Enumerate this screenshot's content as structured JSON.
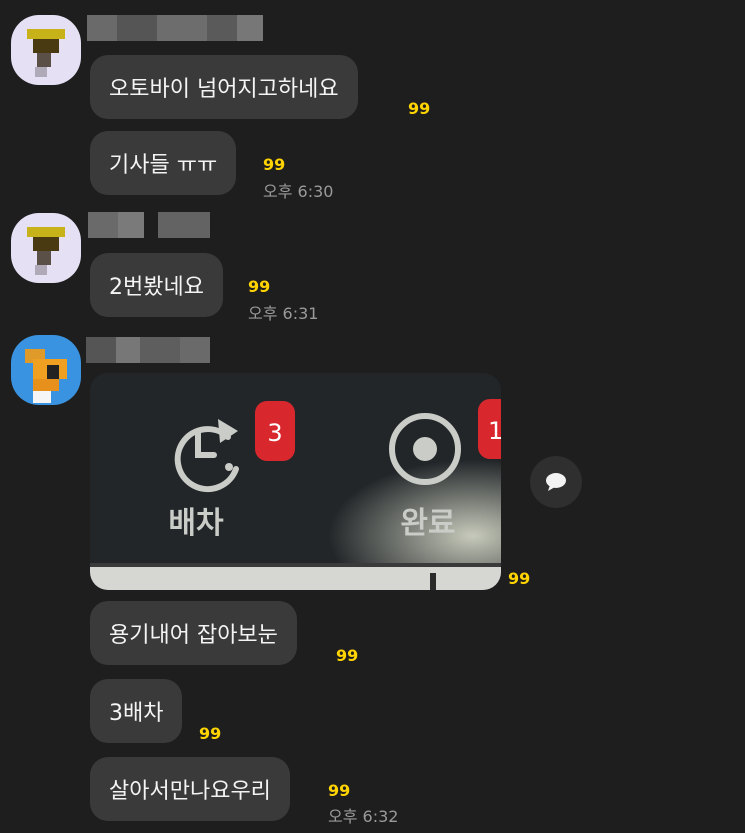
{
  "messages": {
    "m1": {
      "text": "오토바이 넘어지고하네요",
      "unread": "99"
    },
    "m2": {
      "text": "기사들 ㅠㅠ",
      "unread": "99",
      "time": "오후 6:30"
    },
    "m3": {
      "text": "2번봤네요",
      "unread": "99",
      "time": "오후 6:31"
    },
    "m4": {
      "unread": "99",
      "photo": {
        "dispatch_badge": "3",
        "dispatch_label": "배차",
        "complete_badge": "1",
        "complete_label": "완료"
      }
    },
    "m5": {
      "text": "용기내어 잡아보눈",
      "unread": "99"
    },
    "m6": {
      "text": "3배차",
      "unread": "99"
    },
    "m7": {
      "text": "살아서만나요우리",
      "unread": "99",
      "time": "오후 6:32"
    }
  },
  "icons": {
    "share": "speech-bubble-icon"
  },
  "colors": {
    "background": "#1e1e1e",
    "bubble": "#3a3a3a",
    "unread": "#ffd400",
    "time": "#9a9a9a",
    "badge": "#d8282e"
  }
}
